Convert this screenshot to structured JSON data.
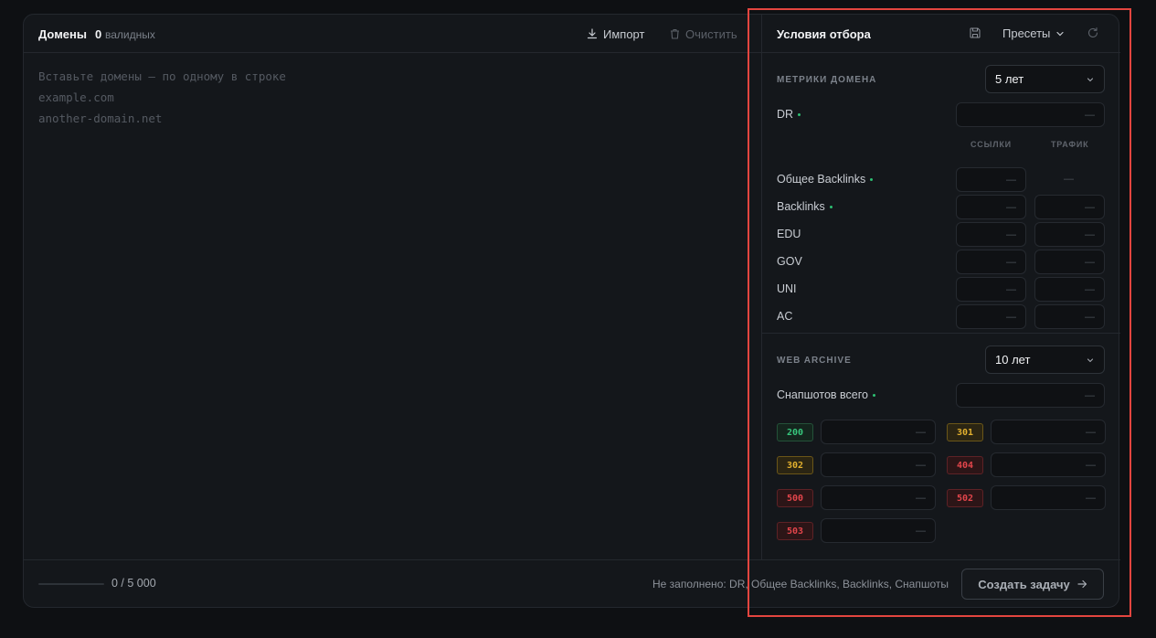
{
  "left": {
    "title": "Домены",
    "valid_count": "0",
    "valid_label": "валидных",
    "import_label": "Импорт",
    "clear_label": "Очистить",
    "placeholder": "Вставьте домены — по одному в строке\nexample.com\nanother-domain.net"
  },
  "footer": {
    "progress": "0 / 5 000",
    "progress_fraction": 0,
    "missing": "Не заполнено: DR, Общее Backlinks, Backlinks, Снапшоты",
    "create_label": "Создать задачу"
  },
  "filters": {
    "title": "Условия отбора",
    "presets_label": "Пресеты",
    "metrics": {
      "label": "МЕТРИКИ ДОМЕНА",
      "period": "5 лет",
      "dr_label": "DR",
      "col_links": "ССЫЛКИ",
      "col_traffic": "ТРАФИК",
      "rows": [
        {
          "label": "Общее Backlinks",
          "required": true
        },
        {
          "label": "Backlinks",
          "required": true
        },
        {
          "label": "EDU",
          "required": false
        },
        {
          "label": "GOV",
          "required": false
        },
        {
          "label": "UNI",
          "required": false
        },
        {
          "label": "AC",
          "required": false
        }
      ]
    },
    "archive": {
      "label": "WEB ARCHIVE",
      "period": "10 лет",
      "snapshots_label": "Снапшотов всего",
      "codes": [
        {
          "code": "200",
          "tone": "green"
        },
        {
          "code": "301",
          "tone": "yellow"
        },
        {
          "code": "302",
          "tone": "yellow"
        },
        {
          "code": "404",
          "tone": "red"
        },
        {
          "code": "500",
          "tone": "red"
        },
        {
          "code": "502",
          "tone": "red"
        },
        {
          "code": "503",
          "tone": "red"
        }
      ]
    },
    "empty_value": "—"
  },
  "colors": {
    "accent_required": "#2dbf72",
    "highlight": "#e3453f"
  }
}
